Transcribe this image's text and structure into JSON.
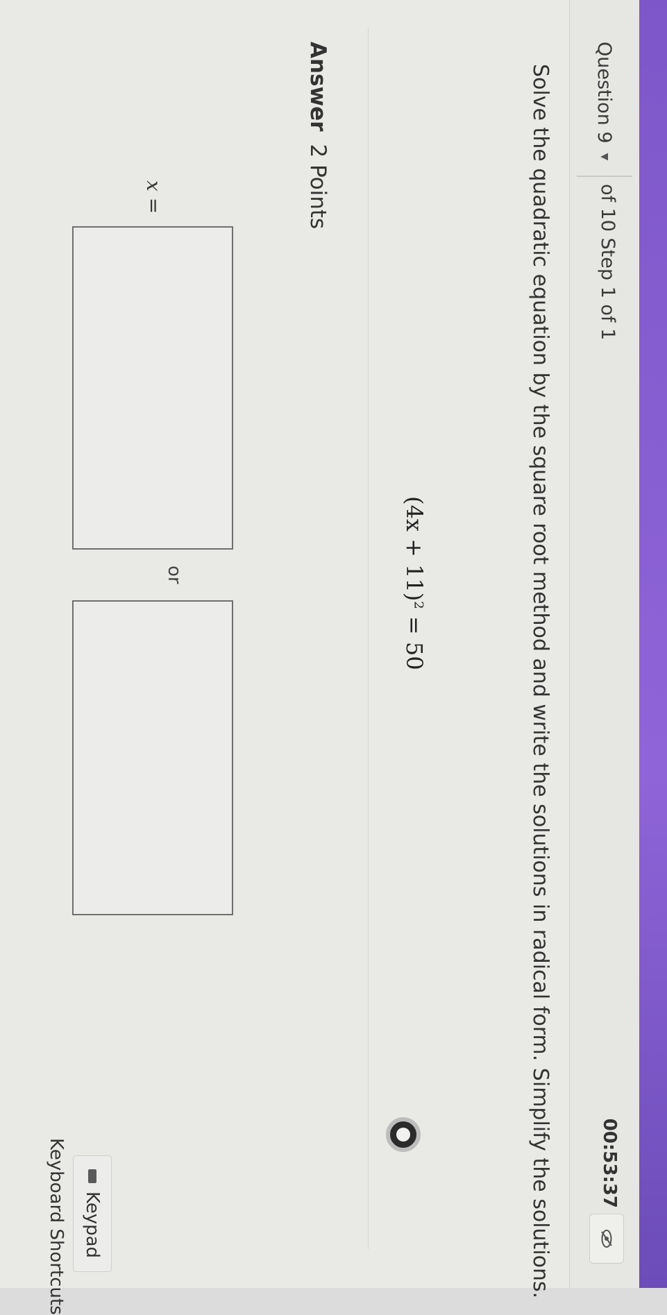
{
  "header": {
    "question_label": "Question 9",
    "step_info": "of 10 Step 1 of 1",
    "timer": "00:53:37"
  },
  "question": {
    "prompt": "Solve the quadratic equation by the square root method and write the solutions in radical form. Simplify the solutions.",
    "equation_base": "(4x + 11)",
    "equation_exponent": "2",
    "equation_rhs": " = 50"
  },
  "answer": {
    "label": "Answer",
    "points": "2 Points",
    "variable": "x",
    "equals": " =",
    "or_label": "or"
  },
  "tools": {
    "keypad_label": "Keypad",
    "shortcuts_label": "Keyboard Shortcuts"
  },
  "colors": {
    "accent_strip": "#8f64d8"
  },
  "icons": {
    "question_dropdown": "chevron-down-icon",
    "visibility": "eye-icon",
    "keypad": "keyboard-icon",
    "loading": "spinner-icon"
  }
}
